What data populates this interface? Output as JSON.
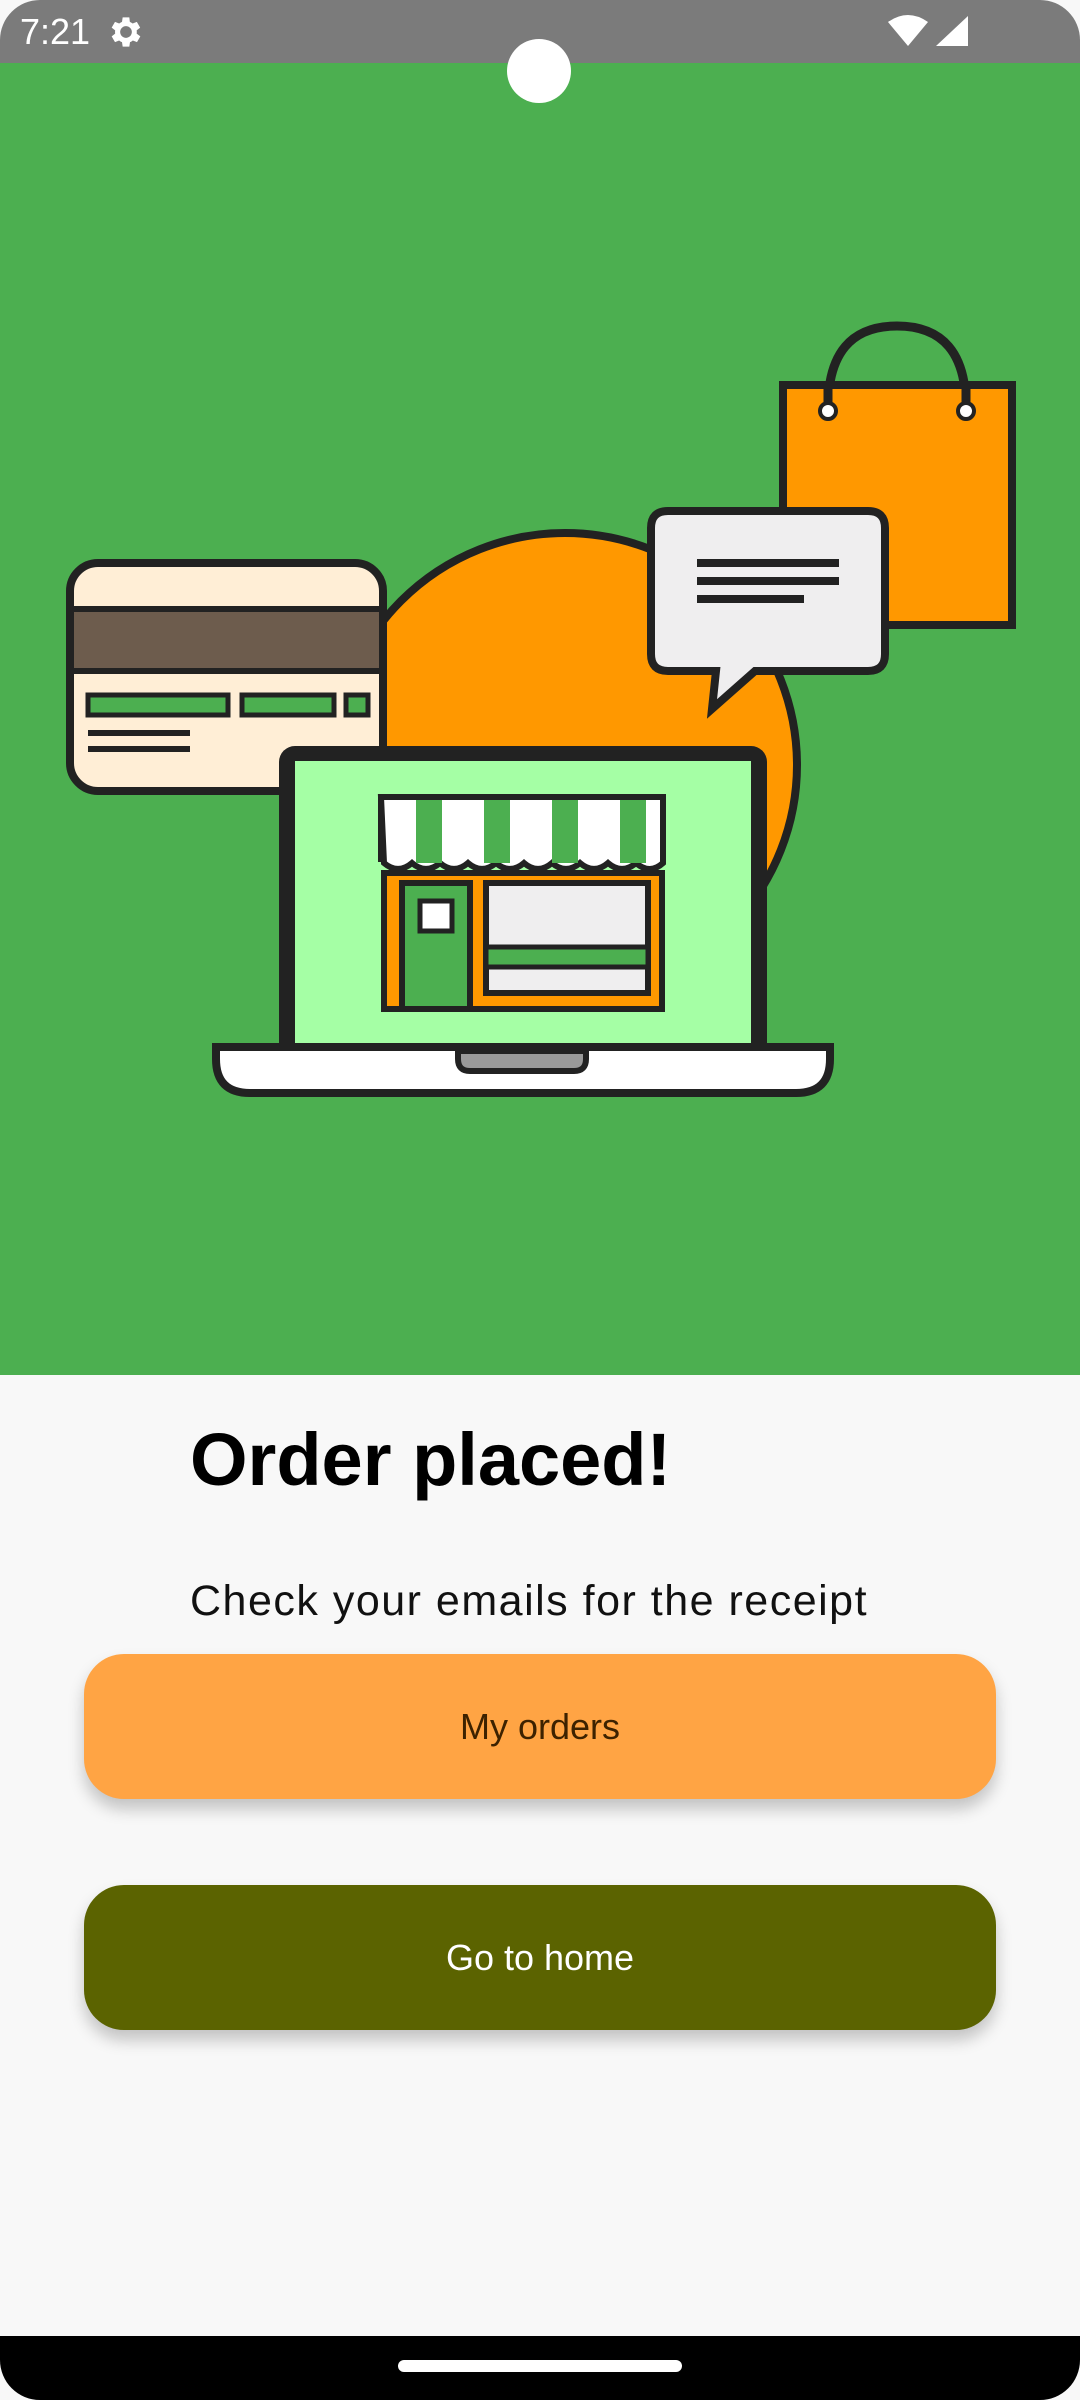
{
  "status_bar": {
    "time": "7:21",
    "icons": [
      "gear-icon",
      "wifi-icon",
      "cell-signal-icon"
    ]
  },
  "hero": {
    "illustration": "online-store-order-illustration",
    "colors": {
      "background": "#4caf50",
      "accent_orange": "#ff9800",
      "screen_green": "#a5ffa5"
    }
  },
  "confirmation": {
    "title": "Order placed!",
    "subtitle": "Check your emails for the receipt"
  },
  "actions": {
    "my_orders_label": "My orders",
    "go_home_label": "Go to home"
  },
  "colors": {
    "my_orders_button": "#ffa444",
    "go_home_button": "#5b6300"
  }
}
